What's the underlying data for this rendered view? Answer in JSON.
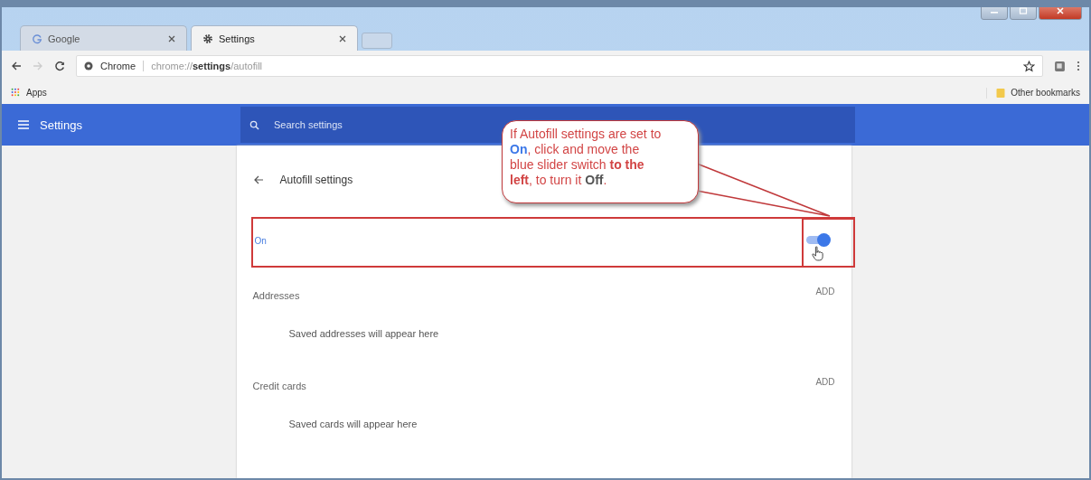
{
  "tabs": [
    {
      "label": "Google",
      "selected": false
    },
    {
      "label": "Settings",
      "selected": true
    }
  ],
  "address_bar": {
    "site": "Chrome",
    "url": "chrome://**settings**/autofill"
  },
  "bookmarks": {
    "apps": "Apps",
    "other": "Other bookmarks"
  },
  "header": {
    "title": "Settings",
    "search_placeholder": "Search settings"
  },
  "page": {
    "title": "Autofill settings",
    "toggle_label": "On",
    "toggle_on": true,
    "sections": [
      {
        "title": "Addresses",
        "action": "ADD",
        "empty_text": "Saved addresses will appear here"
      },
      {
        "title": "Credit cards",
        "action": "ADD",
        "empty_text": "Saved cards will appear here"
      }
    ]
  },
  "callout": {
    "text": "If Autofill settings are set to **On**, click and move the blue slider switch **to the left**, to turn it **Off**."
  }
}
